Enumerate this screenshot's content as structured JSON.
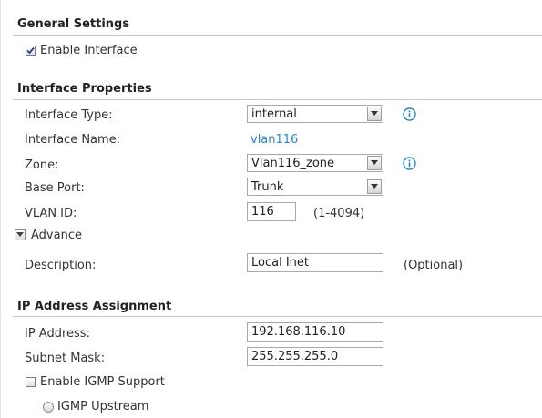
{
  "general": {
    "title": "General Settings",
    "enable_interface_label": "Enable Interface",
    "enable_interface_checked": true
  },
  "props": {
    "title": "Interface Properties",
    "type_label": "Interface Type:",
    "type_value": "internal",
    "name_label": "Interface Name:",
    "name_value": "vlan116",
    "zone_label": "Zone:",
    "zone_value": "Vlan116_zone",
    "base_port_label": "Base Port:",
    "base_port_value": "Trunk",
    "vlan_label": "VLAN ID:",
    "vlan_value": "116",
    "vlan_range": "(1-4094)",
    "advance_label": "Advance",
    "description_label": "Description:",
    "description_value": "Local Inet",
    "optional_hint": "(Optional)"
  },
  "ip": {
    "title": "IP Address Assignment",
    "ip_label": "IP Address:",
    "ip_value": "192.168.116.10",
    "mask_label": "Subnet Mask:",
    "mask_value": "255.255.255.0",
    "igmp_label": "Enable IGMP Support",
    "igmp_checked": false,
    "igmp_upstream_label": "IGMP Upstream"
  },
  "colors": {
    "accent": "#2a88c6",
    "rule": "#c8c8c8"
  },
  "icons": {
    "info": "info-icon",
    "dropdown": "chevron-down-icon",
    "checkmark": "check-icon"
  }
}
